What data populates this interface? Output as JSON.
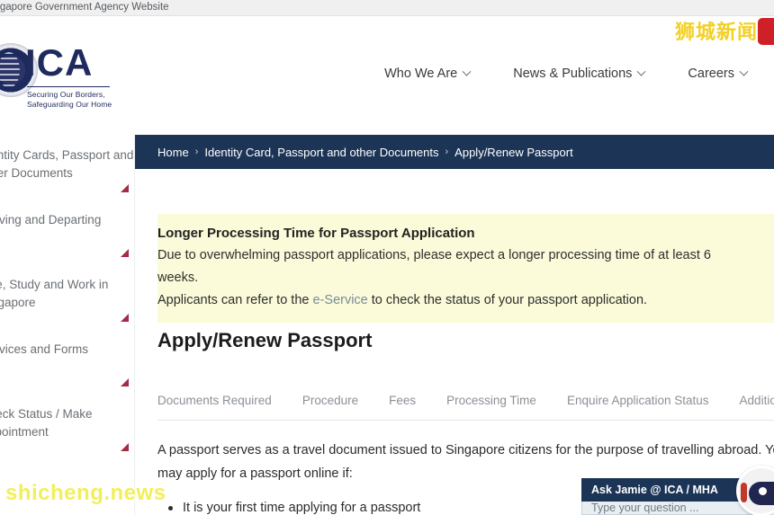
{
  "gov_banner": {
    "text": "A Singapore Government Agency Website"
  },
  "header": {
    "logo": {
      "acronym": "ICA",
      "tagline_line1": "Securing Our Borders,",
      "tagline_line2": "Safeguarding Our Home"
    },
    "nav": [
      {
        "label": "Who We Are"
      },
      {
        "label": "News & Publications"
      },
      {
        "label": "Careers"
      }
    ]
  },
  "breadcrumb": {
    "separator": "›",
    "items": [
      {
        "label": "Home"
      },
      {
        "label": "Identity Card, Passport and other Documents"
      },
      {
        "label": "Apply/Renew Passport"
      }
    ]
  },
  "sidebar": {
    "items": [
      {
        "label": "Identity Cards, Passport and",
        "label2": "other Documents"
      },
      {
        "label": "Arriving and Departing",
        "label2": ""
      },
      {
        "label": "Live, Study and Work in",
        "label2": "Singapore"
      },
      {
        "label": "Services and Forms",
        "label2": ""
      },
      {
        "label": "Check Status / Make",
        "label2": "Appointment"
      }
    ]
  },
  "alert": {
    "title": "Longer Processing Time for Passport Application",
    "line1": "Due to overwhelming passport applications, please expect a longer processing time of at least 6",
    "line2": "weeks.",
    "line3_prefix": "Applicants can refer to the ",
    "line3_link": "e-Service",
    "line3_suffix": " to check the status of your passport application."
  },
  "main": {
    "page_title": "Apply/Renew Passport",
    "tabs": [
      {
        "label": "Documents Required"
      },
      {
        "label": "Procedure"
      },
      {
        "label": "Fees"
      },
      {
        "label": "Processing Time"
      },
      {
        "label": "Enquire Application Status"
      },
      {
        "label": "Additional Information"
      }
    ],
    "body_line1": "A passport serves as a travel document issued to Singapore citizens for the purpose of travelling abroad. You",
    "body_line2": "may apply for a passport online if:",
    "bullets": [
      "It is your first time applying for a passport"
    ]
  },
  "chat_widget": {
    "title": "Ask Jamie @ ICA / MHA",
    "input_placeholder": "Type your question ..."
  },
  "watermarks": {
    "top_right": "狮城新闻",
    "bottom_left": "shicheng.news"
  },
  "colors": {
    "navy": "#1c3557",
    "logo_navy": "#1f2a5e",
    "alert_bg": "#fbfbd9",
    "accent_red": "#a32c46",
    "watermark_yellow": "#f3ef5a",
    "badge_red": "#cf2027"
  }
}
